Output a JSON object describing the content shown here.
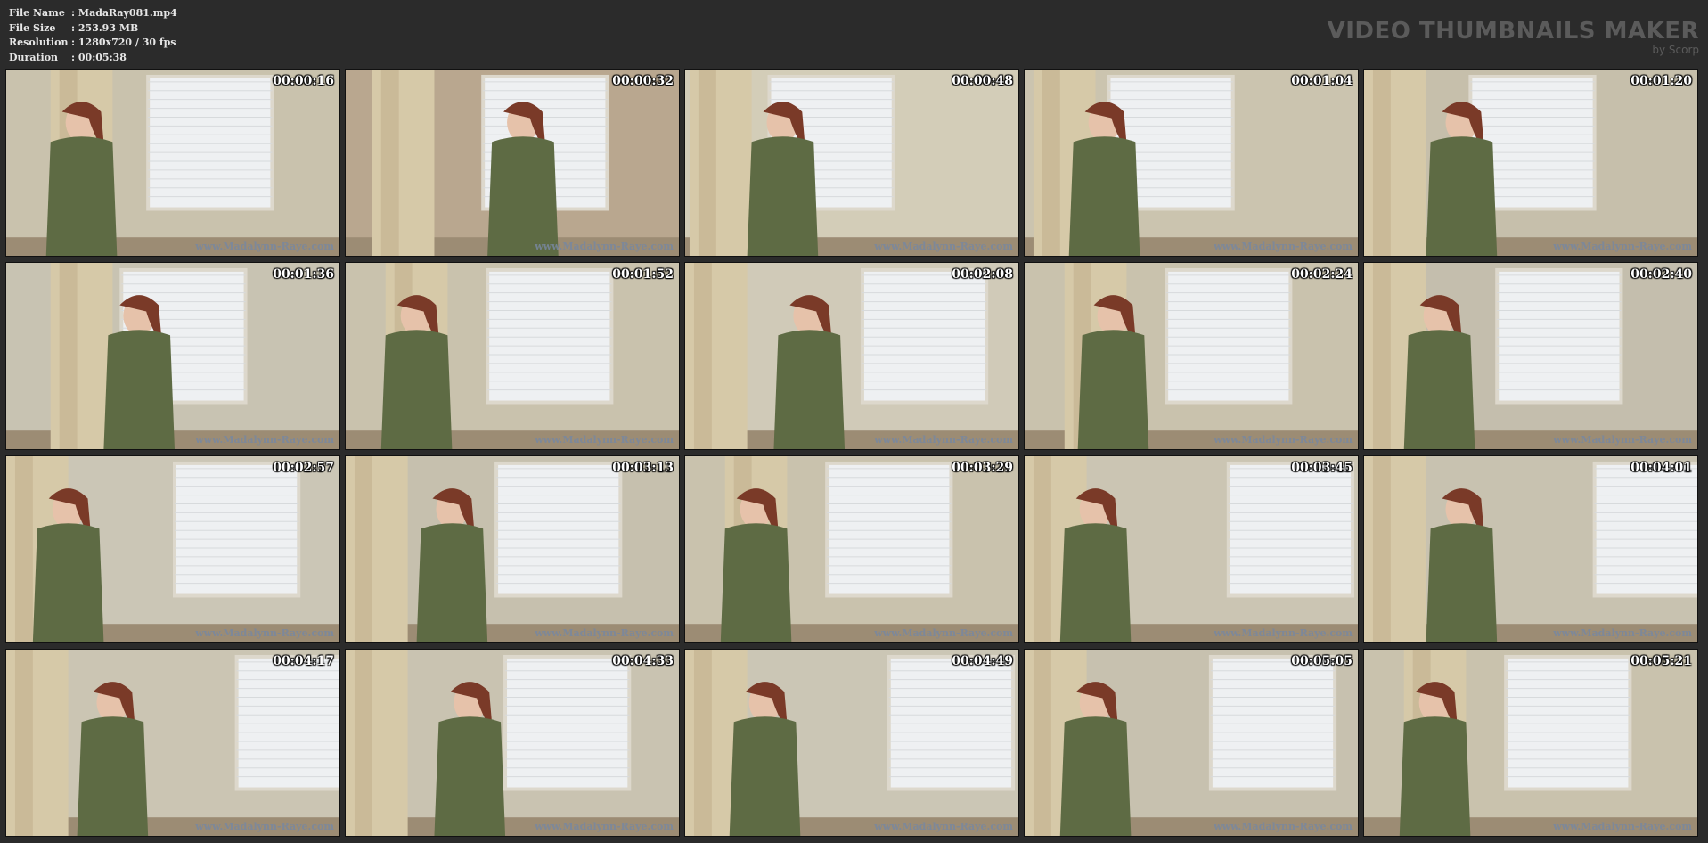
{
  "file_info": {
    "name_label": "File Name",
    "name_value": ":  MadaRay081.mp4",
    "size_label": "File Size",
    "size_value": ":  253.93 MB",
    "res_label": "Resolution",
    "res_value": ":  1280x720 / 30 fps",
    "dur_label": "Duration",
    "dur_value": ":  00:05:38"
  },
  "branding": {
    "title": "VIDEO THUMBNAILS MAKER",
    "byline": "by Scorp"
  },
  "watermark": "www.Madalynn-Raye.com",
  "thumbnails": [
    {
      "timestamp": "00:00:16"
    },
    {
      "timestamp": "00:00:32"
    },
    {
      "timestamp": "00:00:48"
    },
    {
      "timestamp": "00:01:04"
    },
    {
      "timestamp": "00:01:20"
    },
    {
      "timestamp": "00:01:36"
    },
    {
      "timestamp": "00:01:52"
    },
    {
      "timestamp": "00:02:08"
    },
    {
      "timestamp": "00:02:24"
    },
    {
      "timestamp": "00:02:40"
    },
    {
      "timestamp": "00:02:57"
    },
    {
      "timestamp": "00:03:13"
    },
    {
      "timestamp": "00:03:29"
    },
    {
      "timestamp": "00:03:45"
    },
    {
      "timestamp": "00:04:01"
    },
    {
      "timestamp": "00:04:17"
    },
    {
      "timestamp": "00:04:33"
    },
    {
      "timestamp": "00:04:49"
    },
    {
      "timestamp": "00:05:05"
    },
    {
      "timestamp": "00:05:21"
    }
  ]
}
